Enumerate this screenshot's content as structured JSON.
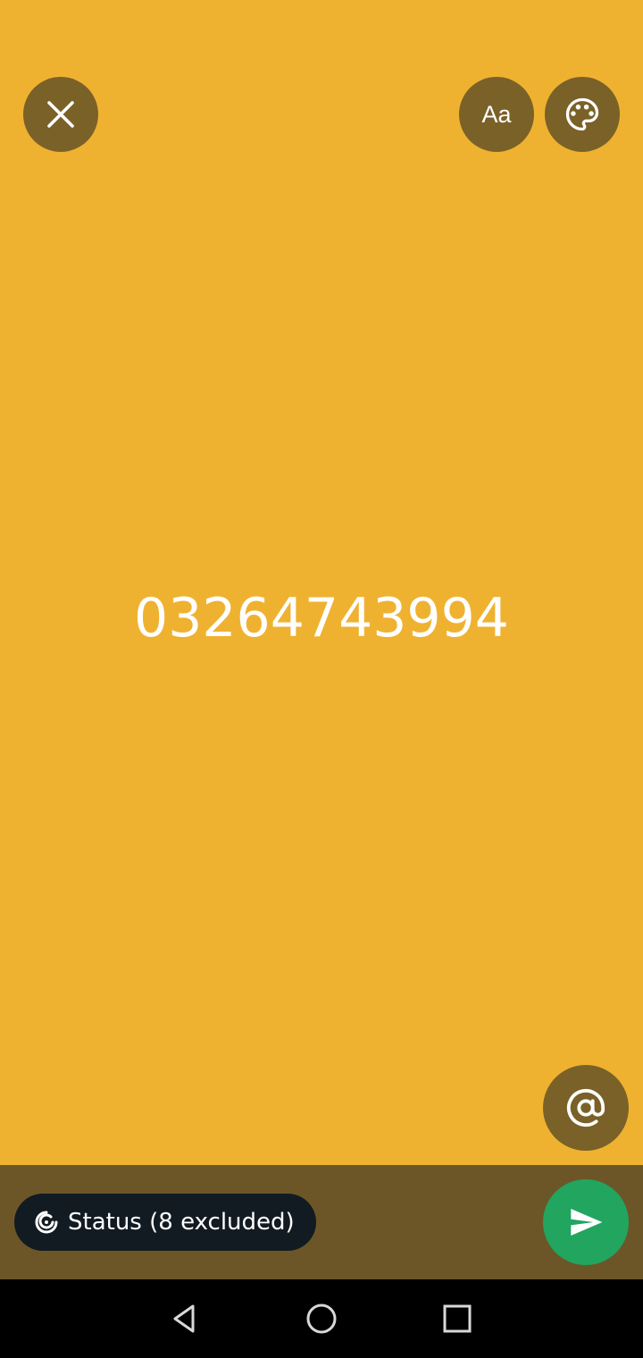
{
  "status_editor": {
    "text": "03264743994",
    "background_color": "#EFB230"
  },
  "toolbar": {
    "close_icon": "close-icon",
    "font_button_label": "Aa",
    "palette_icon": "palette-icon"
  },
  "mention": {
    "icon": "at-sign-icon"
  },
  "bottom_bar": {
    "audience_label": "Status (8 excluded)",
    "audience_icon": "status-ring-icon",
    "send_icon": "send-icon",
    "send_color": "#21A55F"
  },
  "nav": {
    "back_icon": "back-triangle-icon",
    "home_icon": "home-circle-icon",
    "recents_icon": "recents-square-icon"
  }
}
